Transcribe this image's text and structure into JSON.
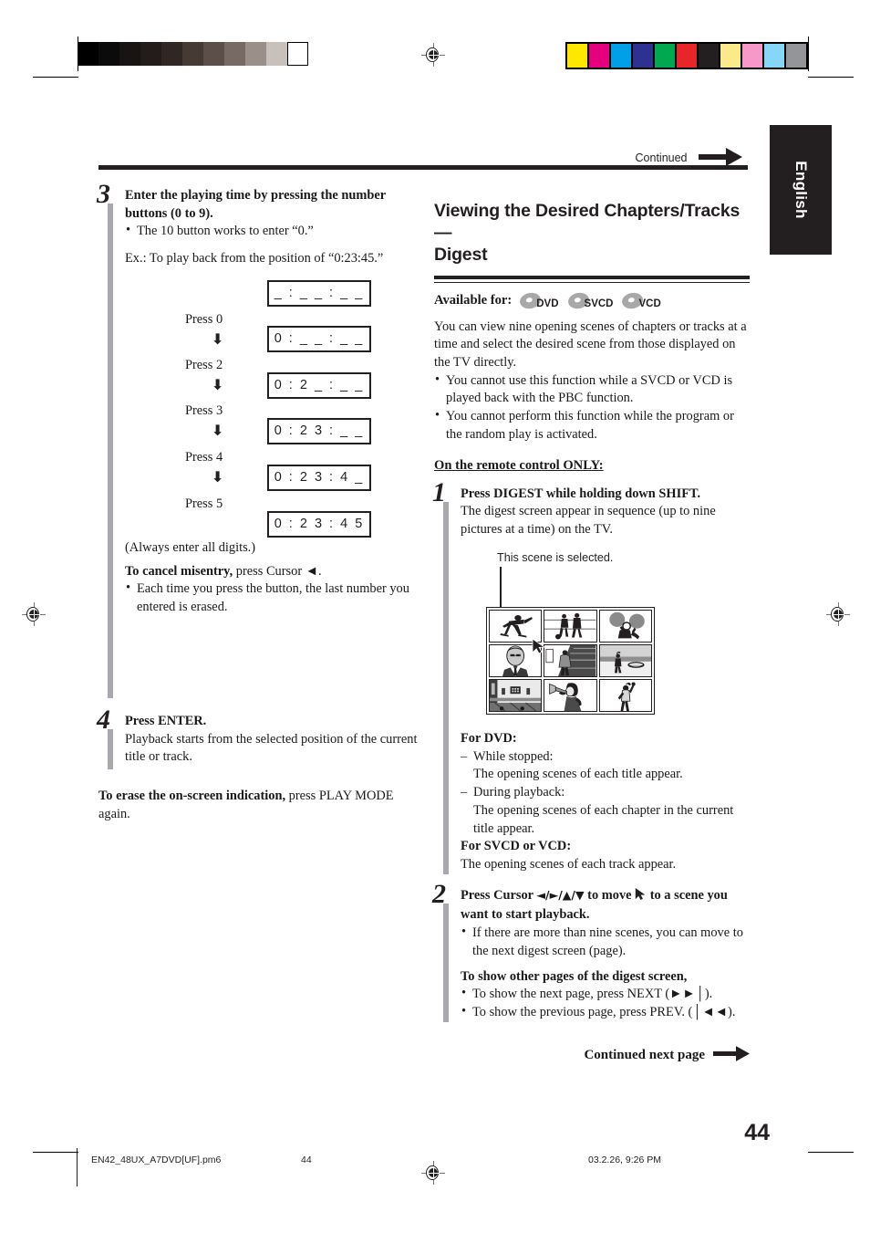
{
  "page": {
    "number": "44",
    "language_tab": "English",
    "continued_top": "Continued",
    "continued_next": "Continued next page"
  },
  "left_column": {
    "step3": {
      "number": "3",
      "heading": "Enter the playing time by pressing the number buttons (0 to 9).",
      "bullets": [
        "The 10 button works to enter “0.”"
      ],
      "example_intro": "Ex.: To play back from the position of “0:23:45.”",
      "time_sequence": [
        {
          "display": "_ : _ _ : _ _",
          "press": "Press 0"
        },
        {
          "display": "0 : _ _ : _ _",
          "press": "Press 2"
        },
        {
          "display": "0 : 2 _ : _ _",
          "press": "Press 3"
        },
        {
          "display": "0 : 2 3 : _ _",
          "press": "Press 4"
        },
        {
          "display": "0 : 2 3 : 4 _",
          "press": "Press 5"
        },
        {
          "display": "0 : 2 3 : 4 5",
          "press": ""
        }
      ],
      "note": "(Always enter all digits.)",
      "cancel_head": "To cancel misentry,",
      "cancel_rest": " press Cursor ◄.",
      "cancel_bullets": [
        "Each time you press the button, the last number you entered is erased."
      ]
    },
    "step4": {
      "number": "4",
      "heading": "Press ENTER.",
      "body": "Playback starts from the selected position of the current title or track."
    },
    "erase_head": "To erase the on-screen indication,",
    "erase_rest": " press PLAY MODE again."
  },
  "right_column": {
    "section_title_line1": "Viewing the Desired Chapters/Tracks—",
    "section_title_line2": "Digest",
    "available_label": "Available for:",
    "available_discs": [
      "DVD",
      "SVCD",
      "VCD"
    ],
    "intro": "You can view nine opening scenes of chapters or tracks at a time and select the desired scene from those displayed on the TV directly.",
    "intro_bullets": [
      "You cannot use this function while a SVCD or VCD is played back with the PBC function.",
      "You cannot perform this function while the program or the random play is activated."
    ],
    "remote_only": "On the remote control ONLY:",
    "step1": {
      "number": "1",
      "heading": "Press DIGEST while holding down SHIFT.",
      "body": "The digest screen appear in sequence (up to nine pictures at a time) on the TV.",
      "figure_caption": "This scene is selected.",
      "scenes": [
        "baseball-pitcher-scene",
        "soccer-players-scene",
        "table-tennis-scene",
        "man-in-suit-scene",
        "tennis-court-scene",
        "beach-scene",
        "stadium-scene",
        "trumpet-player-scene",
        "person-waving-scene"
      ],
      "for_dvd_head": "For DVD:",
      "dvd_items": [
        {
          "term": "While stopped:",
          "desc": "The opening scenes of each title appear."
        },
        {
          "term": "During playback:",
          "desc": "The opening scenes of each chapter in the current title appear."
        }
      ],
      "for_svcd_head": "For SVCD or VCD:",
      "svcd_body": "The opening scenes of each track appear."
    },
    "step2": {
      "number": "2",
      "heading_a": "Press Cursor ",
      "heading_cursors": "◄/►/▲/▼",
      "heading_b": " to move ",
      "heading_c": " to a scene you want to start playback.",
      "bullets": [
        "If there are more than nine scenes, you can move to the next digest screen (page)."
      ],
      "pages_head": "To show other pages of the digest screen,",
      "pages_bullets": [
        "To show the next page, press NEXT (►►│).",
        "To show the previous page, press PREV. (│◄◄)."
      ]
    }
  },
  "footer": {
    "filename": "EN42_48UX_A7DVD[UF].pm6",
    "page": "44",
    "timestamp": "03.2.26, 9:26 PM"
  },
  "calibration": {
    "grayscale": [
      "#000000",
      "#0b0b0b",
      "#181414",
      "#221c1a",
      "#302724",
      "#463a35",
      "#5c4f49",
      "#776a64",
      "#9b9089",
      "#c7c0bb",
      "#ffffff"
    ],
    "colors": [
      "#ffe800",
      "#e5007e",
      "#00a0e9",
      "#2e3192",
      "#00a84f",
      "#e8262a",
      "#231f20",
      "#faea8a",
      "#f799c8",
      "#85d6f7",
      "#939598"
    ]
  }
}
